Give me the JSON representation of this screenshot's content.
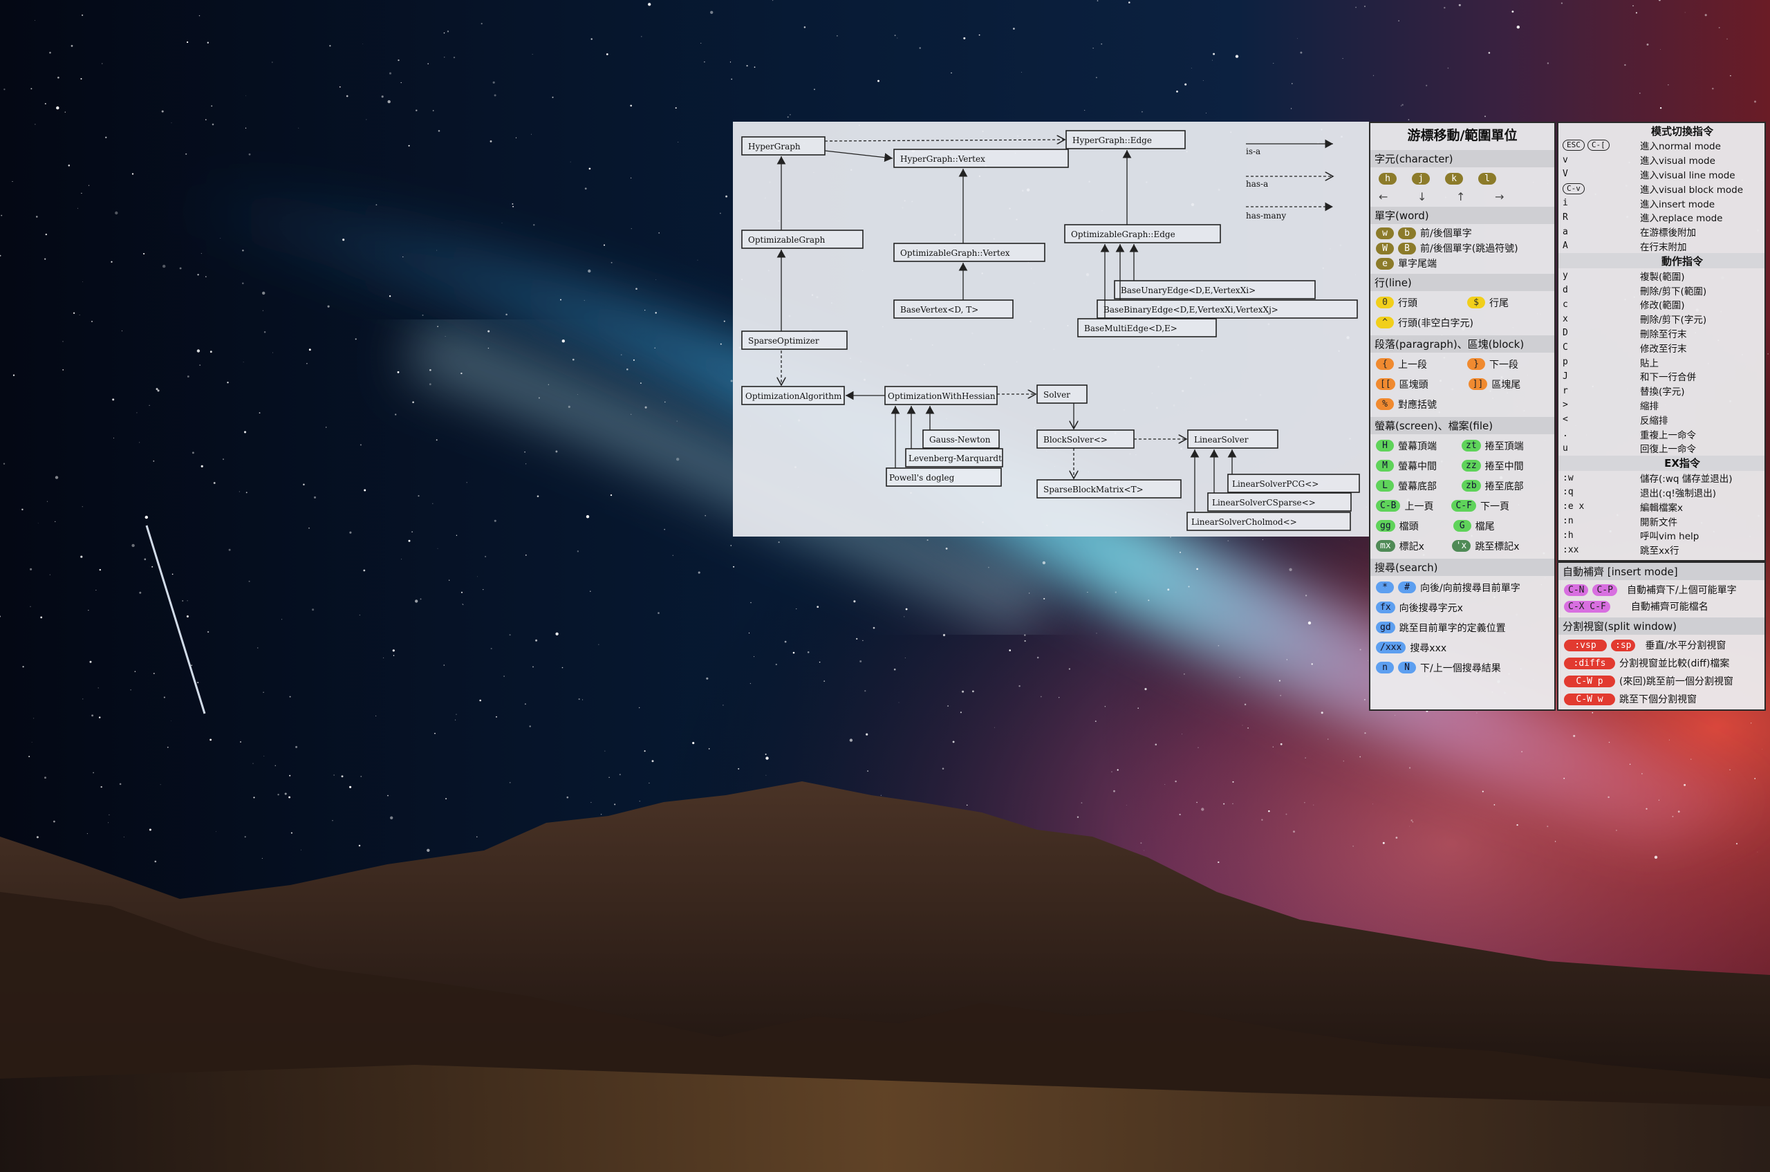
{
  "wallpaper": {
    "description_colors": {
      "sky_top": "#050a1a",
      "milky_way": "#4fb4e6",
      "horizon_pink": "#e2708f",
      "horizon_red": "#c93b3b",
      "mountain": "#3b2a20"
    }
  },
  "g2o": {
    "nodes": {
      "hypergraph": "HyperGraph",
      "hg_edge": "HyperGraph::Edge",
      "hg_vertex": "HyperGraph::Vertex",
      "opt_graph": "OptimizableGraph",
      "opt_vertex": "OptimizableGraph::Vertex",
      "opt_edge": "OptimizableGraph::Edge",
      "base_vertex": "BaseVertex<D, T>",
      "base_unary": "BaseUnaryEdge<D,E,VertexXi>",
      "base_binary": "BaseBinaryEdge<D,E,VertexXi,VertexXj>",
      "base_multi": "BaseMultiEdge<D,E>",
      "sparse_opt": "SparseOptimizer",
      "opt_alg": "OptimizationAlgorithm",
      "opt_hessian": "OptimizationWithHessian",
      "solver": "Solver",
      "gauss": "Gauss-Newton",
      "lm": "Levenberg-Marquardt",
      "dogleg": "Powell's dogleg",
      "block_solver": "BlockSolver<>",
      "linear_solver": "LinearSolver",
      "sparse_block": "SparseBlockMatrix<T>",
      "ls_pcg": "LinearSolverPCG<>",
      "ls_csparse": "LinearSolverCSparse<>",
      "ls_cholmod": "LinearSolverCholmod<>"
    },
    "legend": {
      "is_a": "is-a",
      "has_a": "has-a",
      "has_many": "has-many"
    }
  },
  "motion": {
    "title": "游標移動/範圍單位",
    "char_section": "字元(character)",
    "char_keys": [
      "h",
      "j",
      "k",
      "l"
    ],
    "char_arrows": [
      "←",
      "↓",
      "↑",
      "→"
    ],
    "word_section": "單字(word)",
    "word_rows": [
      {
        "k1": "w",
        "k2": "b",
        "d": "前/後個單字"
      },
      {
        "k1": "W",
        "k2": "B",
        "d": "前/後個單字(跳過符號)"
      },
      {
        "k1": "e",
        "k2": "",
        "d": "單字尾端"
      }
    ],
    "line_section": "行(line)",
    "line_rows": [
      {
        "k1": "0",
        "d1": "行頭",
        "k2": "$",
        "d2": "行尾"
      },
      {
        "k1": "^",
        "d1": "行頭(非空白字元)",
        "k2": "",
        "d2": ""
      }
    ],
    "para_section": "段落(paragraph)、區塊(block)",
    "para_rows": [
      {
        "k1": "{",
        "d1": "上一段",
        "k2": "}",
        "d2": "下一段"
      },
      {
        "k1": "[[",
        "d1": "區塊頭",
        "k2": "]]",
        "d2": "區塊尾"
      },
      {
        "k1": "%",
        "d1": "對應括號",
        "k2": "",
        "d2": ""
      }
    ],
    "screen_section": "螢幕(screen)、檔案(file)",
    "screen_rows": [
      {
        "k1": "H",
        "d1": "螢幕頂端",
        "k2": "zt",
        "d2": "捲至頂端"
      },
      {
        "k1": "M",
        "d1": "螢幕中間",
        "k2": "zz",
        "d2": "捲至中間"
      },
      {
        "k1": "L",
        "d1": "螢幕底部",
        "k2": "zb",
        "d2": "捲至底部"
      },
      {
        "k1": "C-B",
        "d1": "上一頁",
        "k2": "C-F",
        "d2": "下一頁"
      },
      {
        "k1": "gg",
        "d1": "檔頭",
        "k2": "G",
        "d2": "檔尾"
      },
      {
        "k1": "mx",
        "d1": "標記x",
        "k2": "'x",
        "d2": "跳至標記x"
      }
    ],
    "search_section": "搜尋(search)",
    "search_rows": [
      {
        "k1": "*",
        "k2": "#",
        "d": "向後/向前搜尋目前單字"
      },
      {
        "k1": "fx",
        "k2": "",
        "d": "向後搜尋字元x"
      },
      {
        "k1": "gd",
        "k2": "",
        "d": "跳至目前單字的定義位置"
      },
      {
        "k1": "/xxx",
        "k2": "",
        "d": "搜尋xxx"
      },
      {
        "k1": "n",
        "k2": "N",
        "d": "下/上一個搜尋結果"
      }
    ]
  },
  "modes": {
    "title": "模式切換指令",
    "esc_key": "ESC",
    "cbracket_key": "C-[",
    "cv_key": "C-v",
    "mode_rows": [
      {
        "k": "",
        "d": "進入normal mode"
      },
      {
        "k": "v",
        "d": "進入visual mode"
      },
      {
        "k": "V",
        "d": "進入visual line mode"
      },
      {
        "k": "",
        "d": "進入visual block mode"
      },
      {
        "k": "i",
        "d": "進入insert mode"
      },
      {
        "k": "R",
        "d": "進入replace mode"
      },
      {
        "k": "a",
        "d": "在游標後附加"
      },
      {
        "k": "A",
        "d": "在行末附加"
      }
    ],
    "action_title": "動作指令",
    "action_rows": [
      {
        "k": "y",
        "d": "複製(範圍)"
      },
      {
        "k": "d",
        "d": "刪除/剪下(範圍)"
      },
      {
        "k": "c",
        "d": "修改(範圍)"
      },
      {
        "k": "x",
        "d": "刪除/剪下(字元)"
      },
      {
        "k": "D",
        "d": "刪除至行末"
      },
      {
        "k": "C",
        "d": "修改至行末"
      },
      {
        "k": "p",
        "d": "貼上"
      },
      {
        "k": "J",
        "d": "和下一行合併"
      },
      {
        "k": "r",
        "d": "替換(字元)"
      },
      {
        "k": ">",
        "d": "縮排"
      },
      {
        "k": "<",
        "d": "反縮排"
      },
      {
        "k": ".",
        "d": "重複上一命令"
      },
      {
        "k": "u",
        "d": "回復上一命令"
      }
    ],
    "ex_title": "EX指令",
    "ex_rows": [
      {
        "k": ":w",
        "d": "儲存(:wq 儲存並退出)"
      },
      {
        "k": ":q",
        "d": "退出(:q!強制退出)"
      },
      {
        "k": ":e x",
        "d": "編輯檔案x"
      },
      {
        "k": ":n",
        "d": "開新文件"
      },
      {
        "k": ":h",
        "d": "呼叫vim help"
      },
      {
        "k": ":xx",
        "d": "跳至xx行"
      }
    ]
  },
  "insert": {
    "title": "自動補齊 [insert mode]",
    "rows": [
      {
        "k1": "C-N",
        "k2": "C-P",
        "d": "自動補齊下/上個可能單字"
      },
      {
        "k1": "C-X C-F",
        "k2": "",
        "d": "自動補齊可能檔名"
      }
    ],
    "split_title": "分割視窗(split window)",
    "split_rows": [
      {
        "k1": ":vsp",
        "k2": ":sp",
        "d": "垂直/水平分割視窗"
      },
      {
        "k1": ":diffs",
        "k2": "",
        "d": "分割視窗並比較(diff)檔案"
      },
      {
        "k1": "C-W p",
        "k2": "",
        "d": "(來回)跳至前一個分割視窗"
      },
      {
        "k1": "C-W w",
        "k2": "",
        "d": "跳至下個分割視窗"
      }
    ]
  }
}
